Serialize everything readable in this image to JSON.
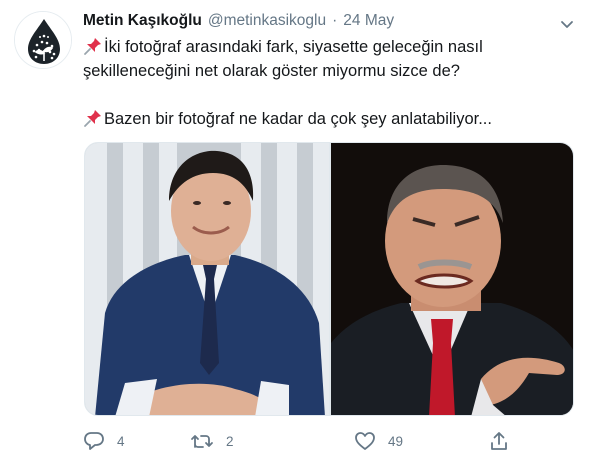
{
  "tweet": {
    "display_name": "Metin Kaşıkoğlu",
    "handle": "@metinkasikoglu",
    "separator": "·",
    "date": "24 May",
    "line1": "İki fotoğraf arasındaki fark, siyasette geleceğin nasıl",
    "line2": "şekilleneceğini net olarak göster miyormu sizce de?",
    "line3": "Bazen bir fotoğraf ne kadar da çok şey anlatabiliyor...",
    "pin_emoji": "pushpin-icon",
    "reply_count": "4",
    "retweet_count": "2",
    "like_count": "49"
  },
  "colors": {
    "text": "#14171a",
    "muted": "#657786",
    "border": "#e1e8ed",
    "avatar_drop": "#1c2329"
  },
  "icons": [
    "caret-down-icon",
    "reply-icon",
    "retweet-icon",
    "like-icon",
    "share-icon"
  ]
}
